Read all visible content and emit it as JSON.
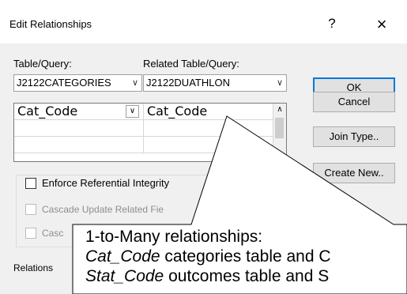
{
  "dialog": {
    "title": "Edit Relationships",
    "help_glyph": "?",
    "close_glyph": "×"
  },
  "tables": {
    "table_label": "Table/Query:",
    "related_label": "Related Table/Query:",
    "table_value": "J2122CATEGORIES",
    "related_value": "J2122DUATHLON"
  },
  "grid": {
    "rows": [
      {
        "left": "Cat_Code",
        "right": "Cat_Code"
      },
      {
        "left": "",
        "right": ""
      },
      {
        "left": "",
        "right": ""
      }
    ]
  },
  "buttons": {
    "ok": "OK",
    "cancel": "Cancel",
    "join_type": "Join Type..",
    "create_new": "Create New.."
  },
  "options": {
    "enforce": "Enforce Referential Integrity",
    "cascade_update": "Cascade Update Related Fie",
    "cascade_delete": "Casc",
    "relationship_type_label": "Relations"
  },
  "callout": {
    "line1": "1-to-Many relationships:",
    "line2_italic": "Cat_Code",
    "line2_rest": " categories table and C",
    "line3_italic": "Stat_Code",
    "line3_rest": " outcomes table and S"
  }
}
